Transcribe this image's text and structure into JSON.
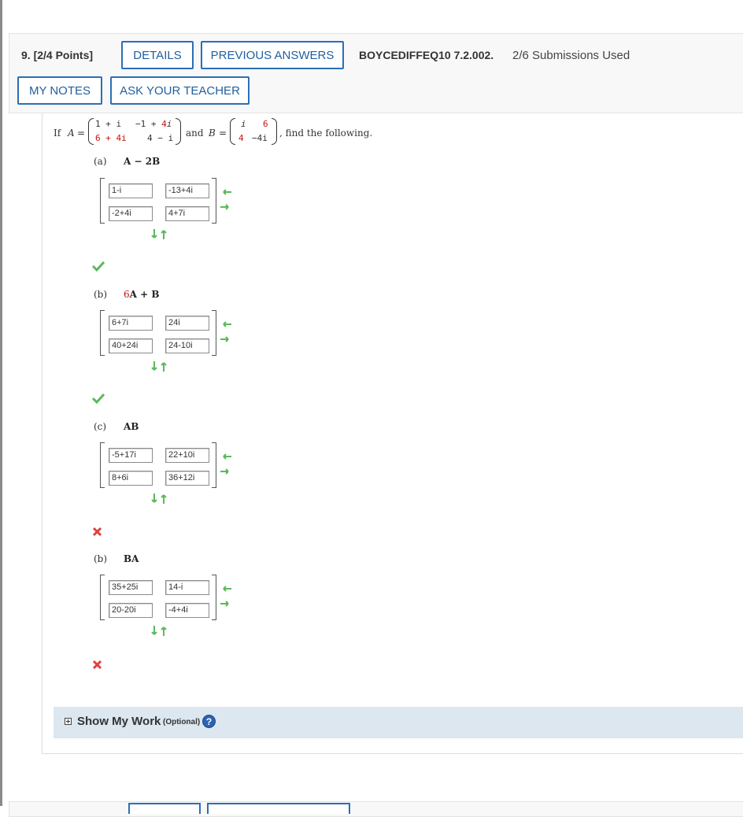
{
  "question": {
    "number": "9.",
    "points": "[2/4 Points]",
    "details_label": "DETAILS",
    "previous_answers_label": "PREVIOUS ANSWERS",
    "code": "BOYCEDIFFEQ10 7.2.002.",
    "submissions": "2/6 Submissions Used",
    "my_notes_label": "MY NOTES",
    "ask_teacher_label": "ASK YOUR TEACHER"
  },
  "problem": {
    "if": "If",
    "a_name": "A",
    "equals": "=",
    "and": "and",
    "b_name": "B",
    "tail": ", find the following.",
    "A": [
      [
        "1 + i",
        "−1 + 4i"
      ],
      [
        "6 + 4i",
        "4 − i"
      ]
    ],
    "B": [
      [
        "i",
        "6"
      ],
      [
        "4",
        "−4i"
      ]
    ]
  },
  "parts": [
    {
      "label": "(a)",
      "expr_prefix": "",
      "expr": "A − 2B",
      "cells": [
        "1-i",
        "-13+4i",
        "-2+4i",
        "4+7i"
      ],
      "status": "correct"
    },
    {
      "label": "(b)",
      "expr_prefix": "6",
      "expr": "A + B",
      "cells": [
        "6+7i",
        "24i",
        "40+24i",
        "24-10i"
      ],
      "status": "correct"
    },
    {
      "label": "(c)",
      "expr_prefix": "",
      "expr": "AB",
      "cells": [
        "-5+17i",
        "22+10i",
        "8+6i",
        "36+12i"
      ],
      "status": "incorrect"
    },
    {
      "label": "(b)",
      "expr_prefix": "",
      "expr": "BA",
      "cells": [
        "35+25i",
        "14-i",
        "20-20i",
        "-4+4i"
      ],
      "status": "incorrect"
    }
  ],
  "show_work": {
    "title": "Show My Work",
    "optional": "(Optional)",
    "help": "?"
  },
  "icons": {
    "check": "checkmark-icon",
    "cross": "x-icon",
    "expand": "plus-box-icon",
    "help": "help-icon"
  },
  "colors": {
    "button_border": "#2a6fb8",
    "correct": "#5cb85c",
    "incorrect": "#e0413c",
    "randomized": "#cc1111",
    "show_work_bg": "#dce7f0"
  }
}
